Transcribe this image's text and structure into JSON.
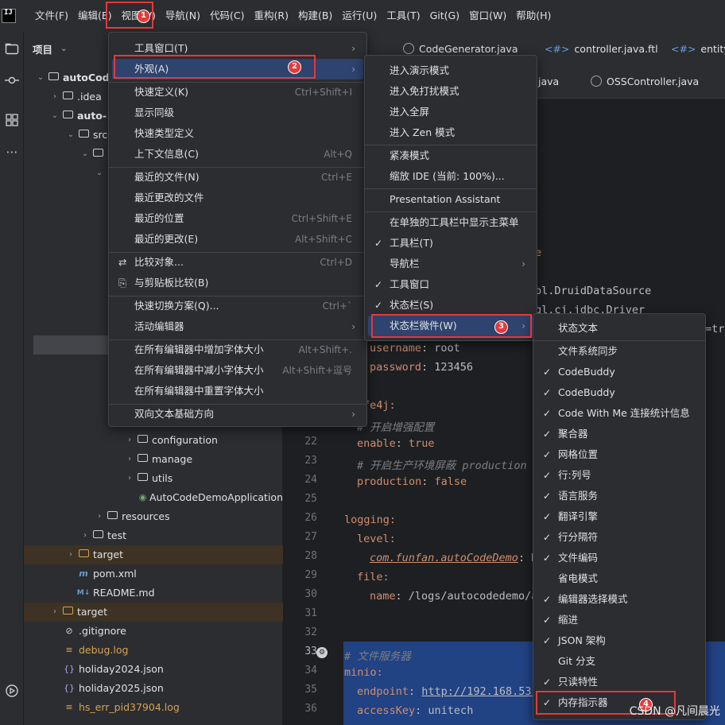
{
  "menubar": {
    "logo_text": "IJ",
    "items": [
      "文件(F)",
      "编辑(E)",
      "视图(V)",
      "导航(N)",
      "代码(C)",
      "重构(R)",
      "构建(B)",
      "运行(U)",
      "工具(T)",
      "Git(G)",
      "窗口(W)",
      "帮助(H)"
    ]
  },
  "project_panel": {
    "title": "项目",
    "tree": [
      {
        "label": "autoCodeDemo",
        "bold": true
      },
      {
        "label": ".idea"
      },
      {
        "label": "auto-",
        "bold": true
      },
      {
        "label": "src"
      },
      {
        "label": "configuration"
      },
      {
        "label": "manage"
      },
      {
        "label": "utils"
      },
      {
        "label": "AutoCodeDemoApplication"
      },
      {
        "label": "resources"
      },
      {
        "label": "test"
      },
      {
        "label": "target"
      },
      {
        "label": "pom.xml"
      },
      {
        "label": "README.md"
      },
      {
        "label": "target"
      },
      {
        "label": ".gitignore"
      },
      {
        "label": "debug.log"
      },
      {
        "label": "holiday2024.json"
      },
      {
        "label": "holiday2025.json"
      },
      {
        "label": "hs_err_pid37904.log"
      }
    ]
  },
  "editor": {
    "tabs": [
      {
        "label": "CodeGenerator.java"
      },
      {
        "label": "controller.java.ftl"
      },
      {
        "label": "entity.java"
      },
      {
        "label": ".java"
      },
      {
        "label": "OSSController.java"
      }
    ],
    "line_numbers": [
      "22",
      "23",
      "24",
      "25",
      "26",
      "27",
      "28",
      "29",
      "30",
      "31",
      "32",
      "33",
      "34",
      "35",
      "36"
    ],
    "code": {
      "l_e": "e",
      "l_druid": "ol.DruidDataSource",
      "l_driver": "ql.cj.jdbc.Driver",
      "l_tr": "=tr",
      "username_key": "username",
      "username_val": "root",
      "password_key": "password",
      "password_val": "123456",
      "knife4j": "fe4j:",
      "c_enhance": "# 开启增强配置",
      "enable_key": "enable",
      "enable_val": "true",
      "c_prod": "# 开启生产环境屏蔽 production",
      "production_key": "production",
      "production_val": "false",
      "logging": "logging:",
      "level": "level:",
      "pkg": "com.funfan.autoCodeDemo",
      "pkg_tail": ": D",
      "file": "file:",
      "name_key": "name",
      "name_val": "/logs/autocodedemo/a",
      "c_minio": "# 文件服务器",
      "minio": "minio:",
      "endpoint_key": "endpoint",
      "endpoint_val": "http://192.168.53.",
      "accesskey_key": "accessKey",
      "accesskey_val": "unitech"
    }
  },
  "view_menu": {
    "items": [
      {
        "label": "工具窗口(T)",
        "shortcut": "",
        "submenu": true
      },
      {
        "label": "外观(A)",
        "shortcut": "",
        "submenu": true
      },
      {
        "label": "快速定义(K)",
        "shortcut": "Ctrl+Shift+I"
      },
      {
        "label": "显示同级",
        "shortcut": ""
      },
      {
        "label": "快速类型定义",
        "shortcut": ""
      },
      {
        "label": "上下文信息(C)",
        "shortcut": "Alt+Q"
      },
      {
        "label": "最近的文件(N)",
        "shortcut": "Ctrl+E"
      },
      {
        "label": "最近更改的文件",
        "shortcut": ""
      },
      {
        "label": "最近的位置",
        "shortcut": "Ctrl+Shift+E"
      },
      {
        "label": "最近的更改(E)",
        "shortcut": "Alt+Shift+C"
      },
      {
        "label": "比较对象...",
        "shortcut": "Ctrl+D"
      },
      {
        "label": "与剪贴板比较(B)",
        "shortcut": ""
      },
      {
        "label": "快速切换方案(Q)...",
        "shortcut": "Ctrl+`"
      },
      {
        "label": "活动编辑器",
        "shortcut": "",
        "submenu": true
      },
      {
        "label": "在所有编辑器中增加字体大小",
        "shortcut": "Alt+Shift+."
      },
      {
        "label": "在所有编辑器中减小字体大小",
        "shortcut": "Alt+Shift+逗号"
      },
      {
        "label": "在所有编辑器中重置字体大小",
        "shortcut": ""
      },
      {
        "label": "双向文本基础方向",
        "shortcut": "",
        "submenu": true
      }
    ]
  },
  "appearance_menu": {
    "items": [
      {
        "label": "进入演示模式"
      },
      {
        "label": "进入免打扰模式"
      },
      {
        "label": "进入全屏"
      },
      {
        "label": "进入 Zen 模式"
      },
      {
        "label": "紧凑模式"
      },
      {
        "label": "缩放 IDE (当前: 100%)..."
      },
      {
        "label": "Presentation Assistant"
      },
      {
        "label": "在单独的工具栏中显示主菜单"
      },
      {
        "label": "工具栏(T)",
        "checked": true
      },
      {
        "label": "导航栏",
        "submenu": true
      },
      {
        "label": "工具窗口",
        "checked": true
      },
      {
        "label": "状态栏(S)",
        "checked": true
      },
      {
        "label": "状态栏微件(W)",
        "submenu": true
      }
    ]
  },
  "widgets_menu": {
    "items": [
      {
        "label": "状态文本",
        "checked": false
      },
      {
        "label": "文件系统同步",
        "checked": false
      },
      {
        "label": "CodeBuddy",
        "checked": true
      },
      {
        "label": "CodeBuddy",
        "checked": true
      },
      {
        "label": "Code With Me 连接统计信息",
        "checked": true
      },
      {
        "label": "聚合器",
        "checked": true
      },
      {
        "label": "网格位置",
        "checked": true
      },
      {
        "label": "行:列号",
        "checked": true
      },
      {
        "label": "语言服务",
        "checked": true
      },
      {
        "label": "翻译引擎",
        "checked": true
      },
      {
        "label": "行分隔符",
        "checked": true
      },
      {
        "label": "文件编码",
        "checked": true
      },
      {
        "label": "省电模式",
        "checked": false
      },
      {
        "label": "编辑器选择模式",
        "checked": true
      },
      {
        "label": "缩进",
        "checked": true
      },
      {
        "label": "JSON 架构",
        "checked": true
      },
      {
        "label": "Git 分支",
        "checked": false
      },
      {
        "label": "只读特性",
        "checked": true
      },
      {
        "label": "内存指示器",
        "checked": true
      }
    ]
  },
  "annotations": {
    "badges": [
      "1",
      "2",
      "3",
      "4"
    ],
    "watermark": "CSDN @凡间晨光"
  },
  "colors": {
    "annotation_red": "#e5393b",
    "menu_highlight": "#2e436e",
    "selection_band": "#214283"
  }
}
